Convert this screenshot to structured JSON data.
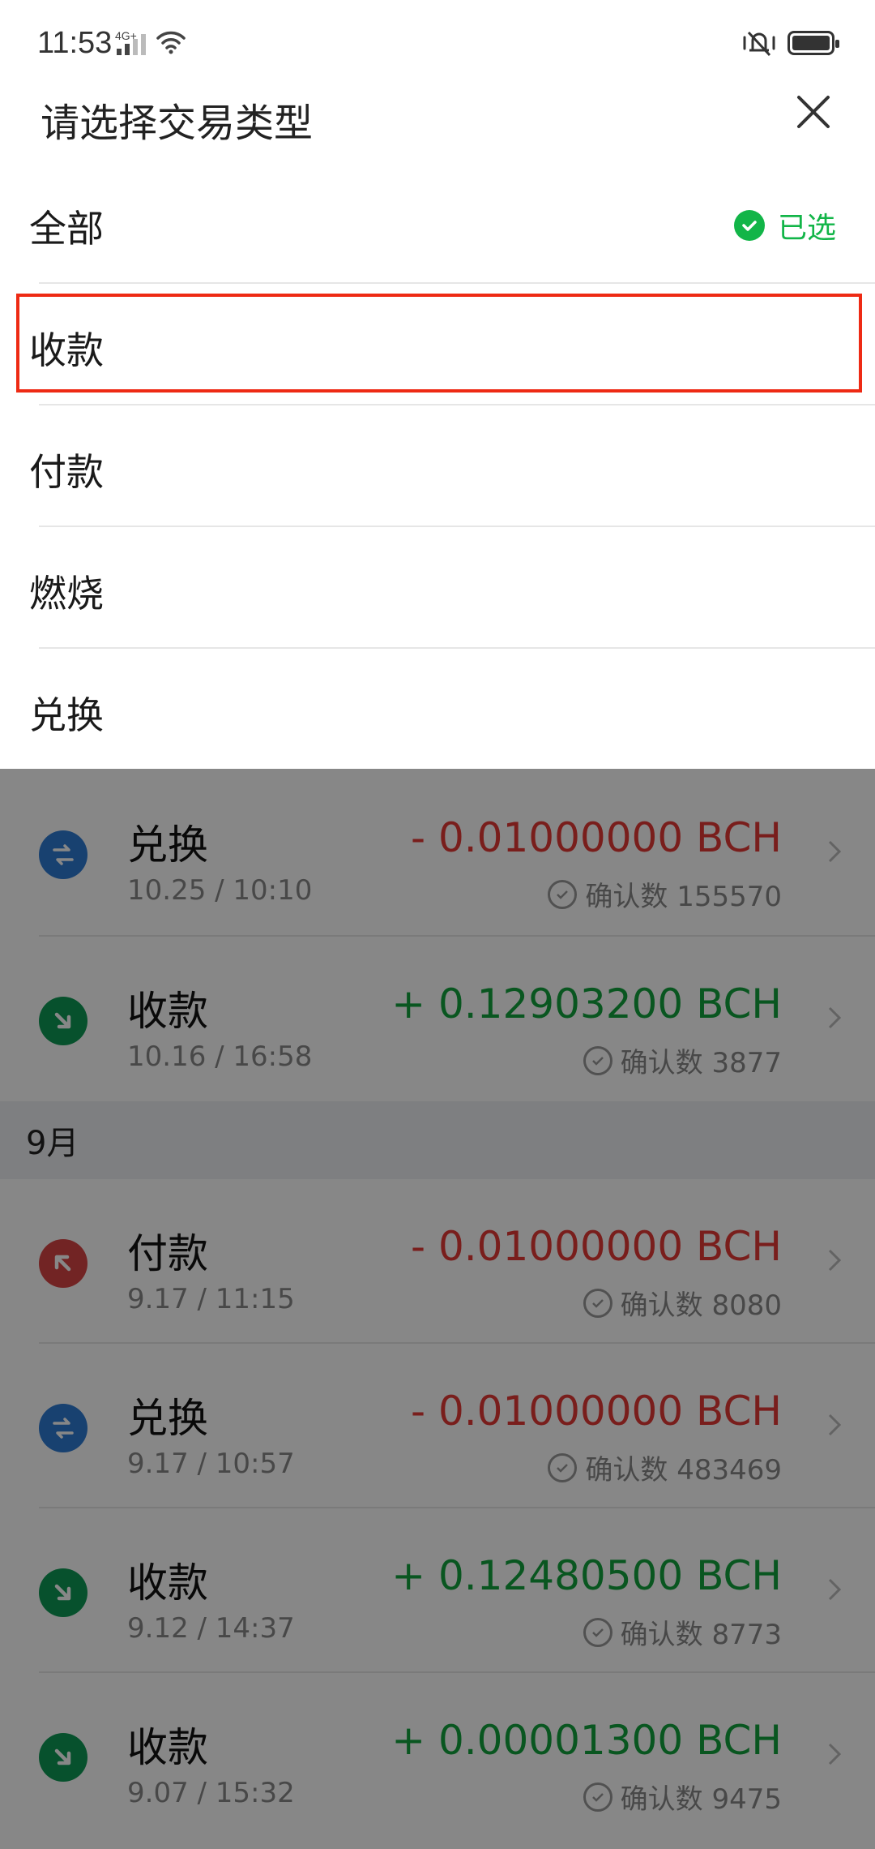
{
  "status_bar": {
    "time": "11:53",
    "network": "4G+"
  },
  "sheet": {
    "title": "请选择交易类型",
    "selected_label": "已选",
    "options": [
      {
        "label": "全部",
        "selected": true
      },
      {
        "label": "收款",
        "selected": false
      },
      {
        "label": "付款",
        "selected": false
      },
      {
        "label": "燃烧",
        "selected": false
      },
      {
        "label": "兑换",
        "selected": false
      }
    ]
  },
  "transactions_before": [
    {
      "type": "兑换",
      "icon": "exchange-icon",
      "time": "10.25 / 10:10",
      "amount": "- 0.01000000 BCH",
      "direction": "out",
      "confirm_label": "确认数 155570"
    },
    {
      "type": "收款",
      "icon": "receive-icon",
      "time": "10.16 / 16:58",
      "amount": "+ 0.12903200 BCH",
      "direction": "in",
      "confirm_label": "确认数 3877"
    }
  ],
  "month_header": "9月",
  "transactions_after": [
    {
      "type": "付款",
      "icon": "send-icon",
      "time": "9.17 / 11:15",
      "amount": "- 0.01000000 BCH",
      "direction": "out",
      "confirm_label": "确认数 8080"
    },
    {
      "type": "兑换",
      "icon": "exchange-icon",
      "time": "9.17 / 10:57",
      "amount": "- 0.01000000 BCH",
      "direction": "out",
      "confirm_label": "确认数 483469"
    },
    {
      "type": "收款",
      "icon": "receive-icon",
      "time": "9.12 / 14:37",
      "amount": "+ 0.12480500 BCH",
      "direction": "in",
      "confirm_label": "确认数 8773"
    },
    {
      "type": "收款",
      "icon": "receive-icon",
      "time": "9.07 / 15:32",
      "amount": "+ 0.00001300 BCH",
      "direction": "in",
      "confirm_label": "确认数 9475"
    }
  ],
  "colors": {
    "exchange": "#2f7bd3",
    "receive": "#0f9a55",
    "send": "#d84545",
    "selected": "#12b548",
    "highlight": "#ee2a14"
  }
}
